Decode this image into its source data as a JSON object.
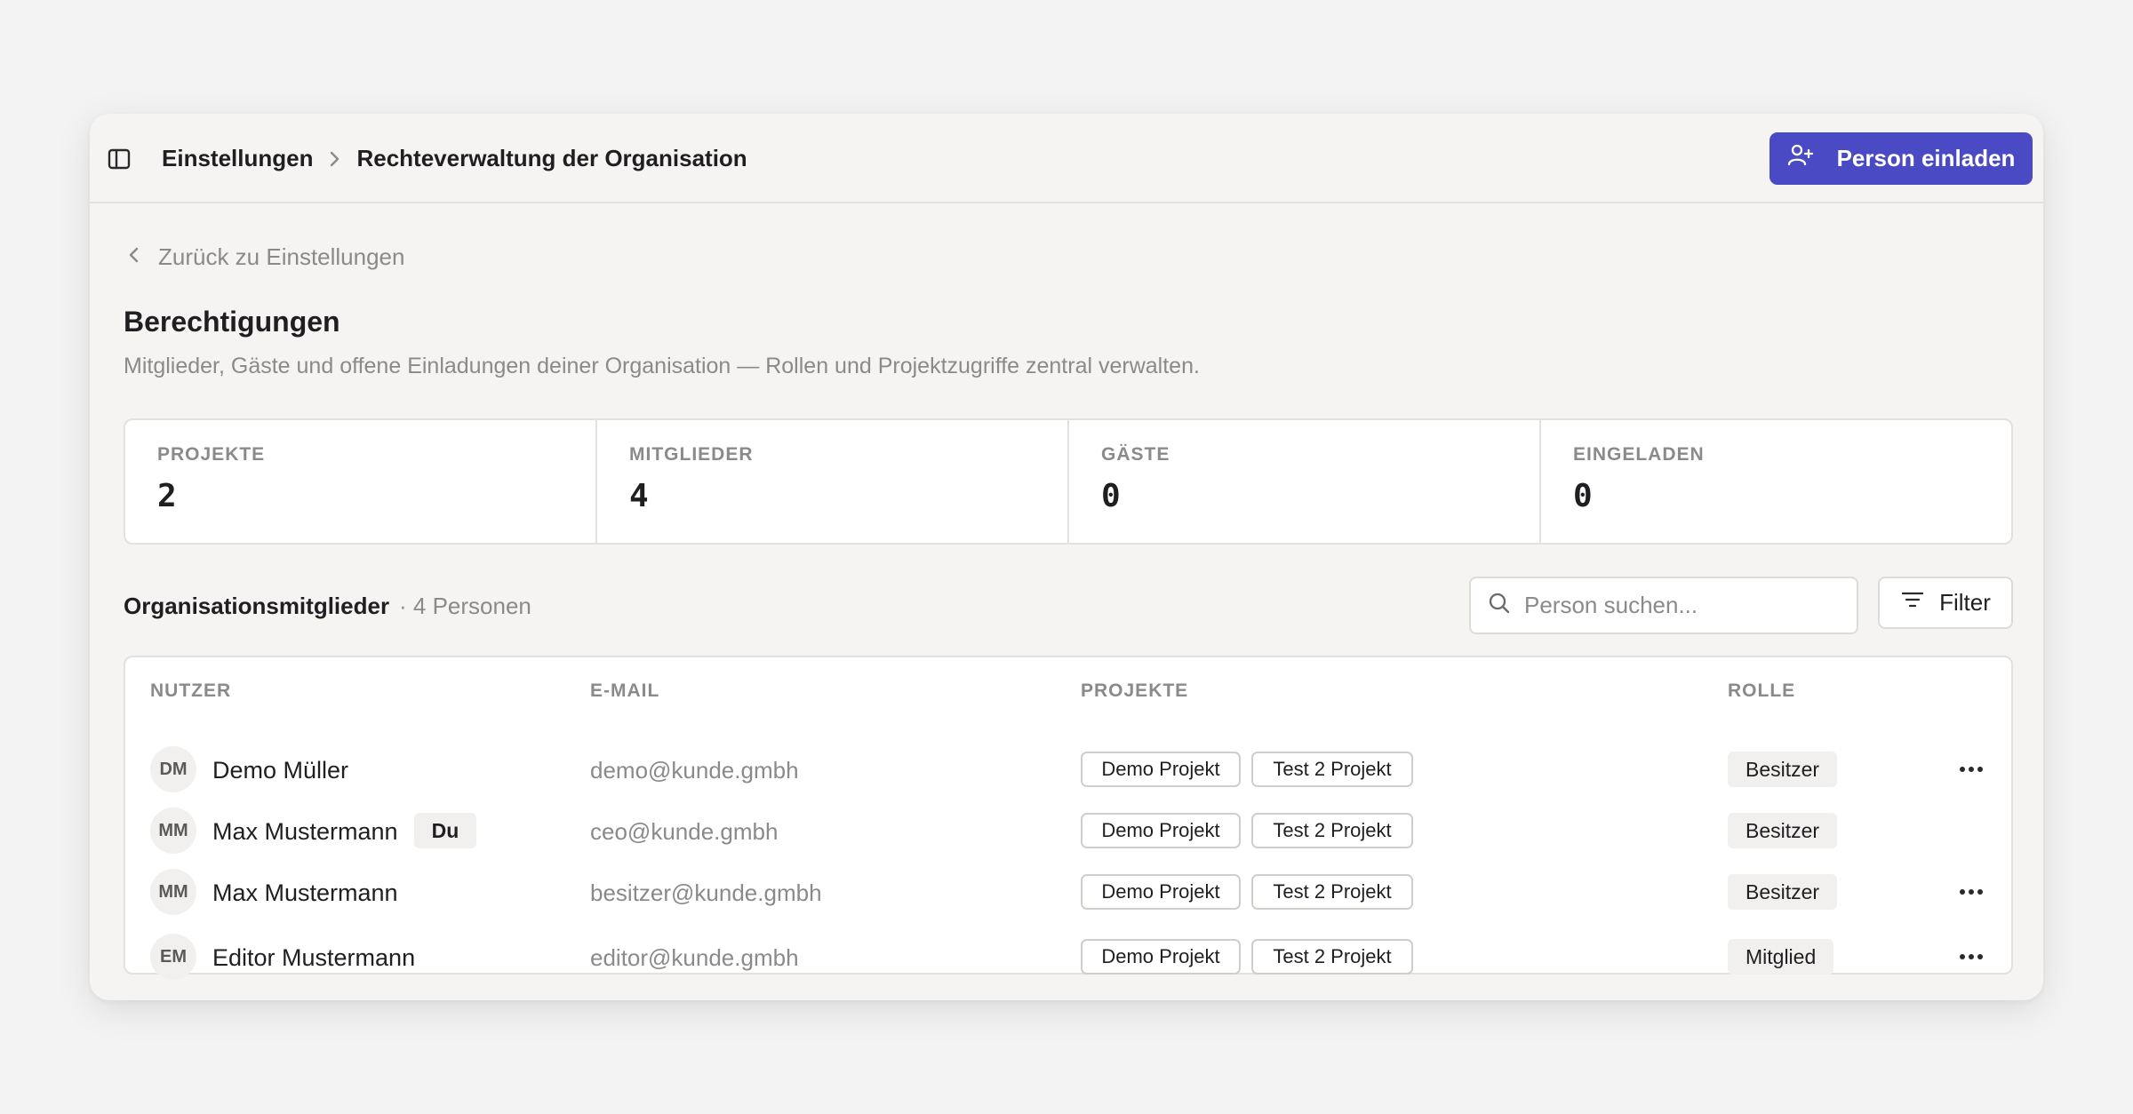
{
  "breadcrumb": {
    "parent": "Einstellungen",
    "current": "Rechteverwaltung der Organisation"
  },
  "invite_button": "Person einladen",
  "back_link": "Zurück zu Einstellungen",
  "page": {
    "title": "Berechtigungen",
    "description": "Mitglieder, Gäste und offene Einladungen deiner Organisation — Rollen und Projektzugriffe zentral verwalten."
  },
  "stats": [
    {
      "label": "PROJEKTE",
      "value": "2"
    },
    {
      "label": "MITGLIEDER",
      "value": "4"
    },
    {
      "label": "GÄSTE",
      "value": "0"
    },
    {
      "label": "EINGELADEN",
      "value": "0"
    }
  ],
  "members_section": {
    "title": "Organisationsmitglieder",
    "count": "· 4 Personen",
    "search_placeholder": "Person suchen...",
    "filter_label": "Filter"
  },
  "table": {
    "headers": {
      "user": "NUTZER",
      "email": "E-MAIL",
      "projects": "PROJEKTE",
      "role": "ROLLE"
    },
    "rows": [
      {
        "initials": "DM",
        "name": "Demo Müller",
        "badge": "",
        "email": "demo@kunde.gmbh",
        "projects": [
          "Demo Projekt",
          "Test 2 Projekt"
        ],
        "role": "Besitzer",
        "has_menu": true
      },
      {
        "initials": "MM",
        "name": "Max Mustermann",
        "badge": "Du",
        "email": "ceo@kunde.gmbh",
        "projects": [
          "Demo Projekt",
          "Test 2 Projekt"
        ],
        "role": "Besitzer",
        "has_menu": false
      },
      {
        "initials": "MM",
        "name": "Max Mustermann",
        "badge": "",
        "email": "besitzer@kunde.gmbh",
        "projects": [
          "Demo Projekt",
          "Test 2 Projekt"
        ],
        "role": "Besitzer",
        "has_menu": true
      },
      {
        "initials": "EM",
        "name": "Editor Mustermann",
        "badge": "",
        "email": "editor@kunde.gmbh",
        "projects": [
          "Demo Projekt",
          "Test 2 Projekt"
        ],
        "role": "Mitglied",
        "has_menu": true
      }
    ]
  },
  "colors": {
    "accent": "#4a4bc4"
  },
  "icons": {
    "sidebar": "sidebar-toggle-icon",
    "chevron": "chevron-right-icon",
    "back": "chevron-left-icon",
    "invite": "user-plus-icon",
    "search": "search-icon",
    "filter": "filter-icon",
    "more": "more-horizontal-icon"
  }
}
